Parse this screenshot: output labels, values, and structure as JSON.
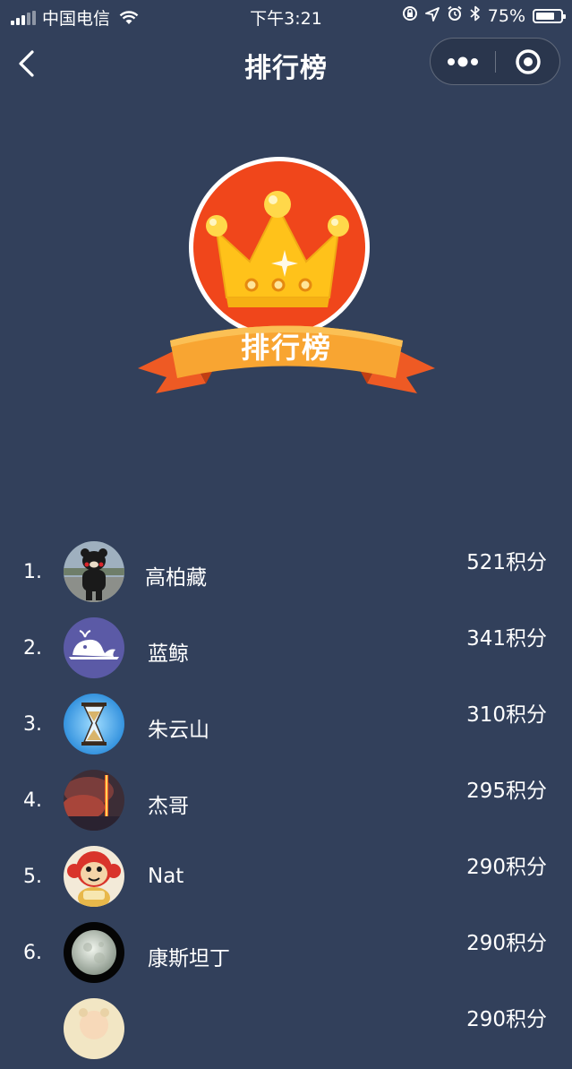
{
  "status_bar": {
    "carrier": "中国电信",
    "time": "下午3:21",
    "battery": "75%",
    "battery_level": 0.75
  },
  "nav": {
    "title": "排行榜",
    "icons": [
      "chevron-left-icon",
      "more-dots-icon",
      "close-circle-icon"
    ]
  },
  "badge": {
    "label": "排行榜",
    "colors": {
      "circle": "#f0461b",
      "crown": "#ffc21a",
      "ribbon": "#f8a532",
      "ribbon_tail": "#ee5a24"
    }
  },
  "ranking": [
    {
      "rank": "1.",
      "name": "高柏藏",
      "score": "521积分",
      "avatar": "bear-avatar"
    },
    {
      "rank": "2.",
      "name": "蓝鲸",
      "score": "341积分",
      "avatar": "whale-avatar"
    },
    {
      "rank": "3.",
      "name": "朱云山",
      "score": "310积分",
      "avatar": "hourglass-avatar"
    },
    {
      "rank": "4.",
      "name": "杰哥",
      "score": "295积分",
      "avatar": "volcano-avatar"
    },
    {
      "rank": "5.",
      "name": "Nat",
      "score": "290积分",
      "avatar": "monkey-avatar"
    },
    {
      "rank": "6.",
      "name": "康斯坦丁",
      "score": "290积分",
      "avatar": "moon-avatar"
    },
    {
      "rank": "",
      "name": "",
      "score": "290积分",
      "avatar": "child-avatar"
    }
  ],
  "colors": {
    "background": "#32405b",
    "text": "#ffffff"
  }
}
